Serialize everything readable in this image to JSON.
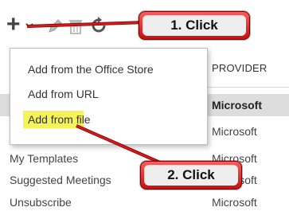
{
  "toolbar": {
    "icons": [
      "plus-icon",
      "chevron-down-icon",
      "pencil-icon",
      "trash-icon",
      "refresh-icon"
    ]
  },
  "table": {
    "provider_header": "PROVIDER",
    "rows": [
      {
        "name": "",
        "provider": "Microsoft",
        "selected": true
      },
      {
        "name": "",
        "provider": "Microsoft",
        "selected": false
      },
      {
        "name": "My Templates",
        "provider": "Microsoft",
        "selected": false
      },
      {
        "name": "Suggested Meetings",
        "provider": "Microsoft",
        "selected": false
      },
      {
        "name": "Unsubscribe",
        "provider": "Microsoft",
        "selected": false
      }
    ]
  },
  "menu": {
    "items": [
      {
        "label": "Add from the Office Store"
      },
      {
        "label": "Add from URL"
      },
      {
        "label": "Add from file"
      }
    ]
  },
  "callouts": {
    "step1": "1. Click",
    "step2": "2. Click"
  },
  "colors": {
    "callout_red": "#d61a1a",
    "highlight_yellow": "#f6f25a",
    "selected_row": "#dddddd"
  }
}
